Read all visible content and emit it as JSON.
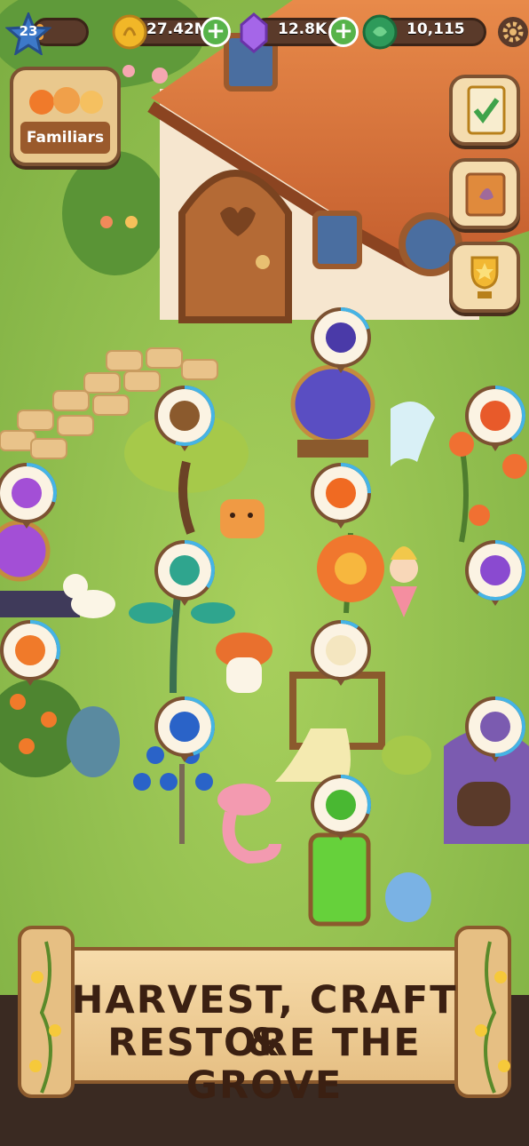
{
  "hud": {
    "level": "23",
    "level_progress": 0.15,
    "coins": "27.42M",
    "gems": "12.8K",
    "leaves": "10,115"
  },
  "familiars": {
    "label": "Familiars"
  },
  "banner": {
    "line1": "HARVEST, CRAFT &",
    "line2": "RESTORE THE GROVE"
  },
  "icons": {
    "level": "star-icon",
    "coin": "coin-icon",
    "gem": "gem-icon",
    "leaf": "leaf-token-icon",
    "settings": "gear-icon",
    "quests": "checklist-icon",
    "journal": "book-icon",
    "trophy": "trophy-icon"
  },
  "stations": [
    {
      "name": "potion-bottle",
      "progress": 0.3
    },
    {
      "name": "twig-bundle",
      "progress": 0.55
    },
    {
      "name": "fire-flower",
      "progress": 0.4
    },
    {
      "name": "purple-potion",
      "progress": 0.2
    },
    {
      "name": "fire-fruit",
      "progress": 0.25
    },
    {
      "name": "teal-mushroom",
      "progress": 0.35
    },
    {
      "name": "violet-flower",
      "progress": 0.6
    },
    {
      "name": "orange-blossom",
      "progress": 0.3
    },
    {
      "name": "parchment-scroll",
      "progress": 0.1
    },
    {
      "name": "blue-apple",
      "progress": 0.45
    },
    {
      "name": "stardust-pie",
      "progress": 0.5
    },
    {
      "name": "green-elixir",
      "progress": 0.3
    }
  ],
  "colors": {
    "grass": "#8fc04f",
    "roof": "#d8713d",
    "wood": "#7c5232",
    "accent_plus": "#57b34a",
    "progress_ring": "#45b4e6",
    "banner_text": "#3b2012"
  }
}
